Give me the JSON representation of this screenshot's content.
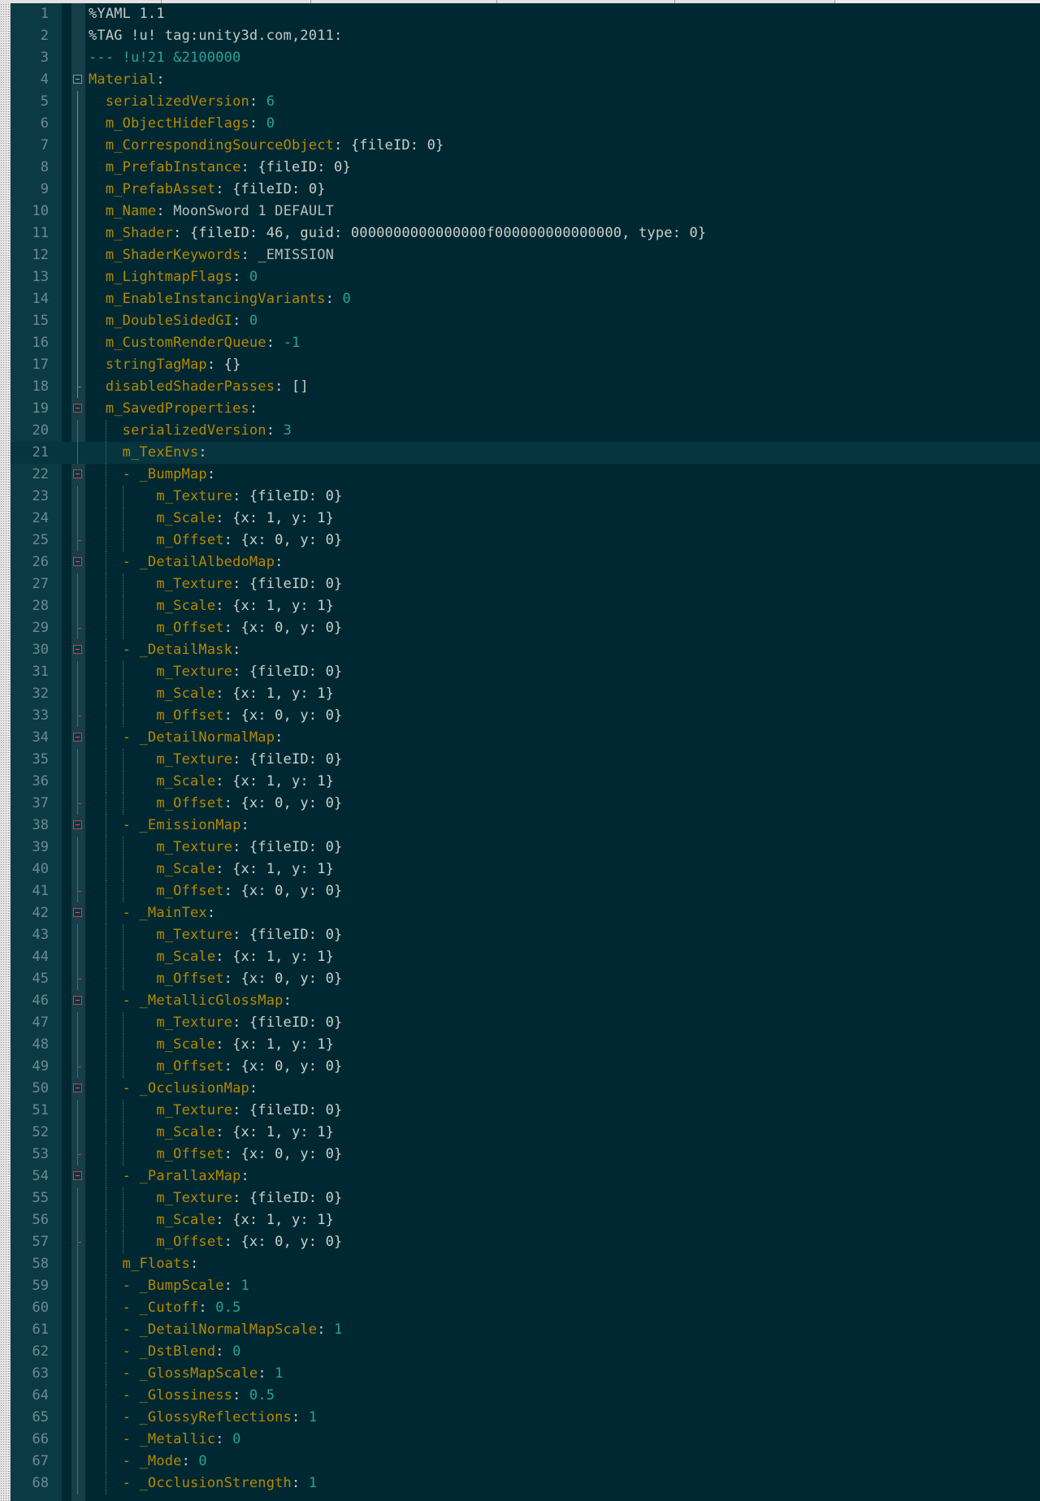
{
  "editor": {
    "colors": {
      "background": "#002833",
      "line_number": "#6d8a92",
      "directive": "#c4cac4",
      "document_marker": "#2aa198",
      "key": "#b58900",
      "string": "#b7bfb7",
      "number": "#2aa198",
      "punct": "#c9d1c9",
      "fold_marker": "#d23b45"
    },
    "current_line": 21,
    "lines": [
      {
        "n": "1",
        "tokens": [
          [
            "dir",
            "%YAML 1.1"
          ]
        ]
      },
      {
        "n": "2",
        "tokens": [
          [
            "dir",
            "%TAG !u! tag:unity3d.com,2011:"
          ]
        ]
      },
      {
        "n": "3",
        "tokens": [
          [
            "doc",
            "--- !u!21 &2100000"
          ]
        ]
      },
      {
        "n": "4",
        "tokens": [
          [
            "key",
            "Material"
          ],
          [
            "p",
            ":"
          ]
        ]
      },
      {
        "n": "5",
        "tokens": [
          [
            "sp",
            "  "
          ],
          [
            "key",
            "serializedVersion"
          ],
          [
            "p",
            ": "
          ],
          [
            "num",
            "6"
          ]
        ]
      },
      {
        "n": "6",
        "tokens": [
          [
            "sp",
            "  "
          ],
          [
            "key",
            "m_ObjectHideFlags"
          ],
          [
            "p",
            ": "
          ],
          [
            "num",
            "0"
          ]
        ]
      },
      {
        "n": "7",
        "tokens": [
          [
            "sp",
            "  "
          ],
          [
            "key",
            "m_CorrespondingSourceObject"
          ],
          [
            "p",
            ": {fileID: 0}"
          ]
        ]
      },
      {
        "n": "8",
        "tokens": [
          [
            "sp",
            "  "
          ],
          [
            "key",
            "m_PrefabInstance"
          ],
          [
            "p",
            ": {fileID: 0}"
          ]
        ]
      },
      {
        "n": "9",
        "tokens": [
          [
            "sp",
            "  "
          ],
          [
            "key",
            "m_PrefabAsset"
          ],
          [
            "p",
            ": {fileID: 0}"
          ]
        ]
      },
      {
        "n": "10",
        "tokens": [
          [
            "sp",
            "  "
          ],
          [
            "key",
            "m_Name"
          ],
          [
            "p",
            ": "
          ],
          [
            "str",
            "MoonSword 1 DEFAULT"
          ]
        ]
      },
      {
        "n": "11",
        "tokens": [
          [
            "sp",
            "  "
          ],
          [
            "key",
            "m_Shader"
          ],
          [
            "p",
            ": {fileID: 46, guid: 0000000000000000f000000000000000, type: 0}"
          ]
        ]
      },
      {
        "n": "12",
        "tokens": [
          [
            "sp",
            "  "
          ],
          [
            "key",
            "m_ShaderKeywords"
          ],
          [
            "p",
            ": "
          ],
          [
            "str",
            "_EMISSION"
          ]
        ]
      },
      {
        "n": "13",
        "tokens": [
          [
            "sp",
            "  "
          ],
          [
            "key",
            "m_LightmapFlags"
          ],
          [
            "p",
            ": "
          ],
          [
            "num",
            "0"
          ]
        ]
      },
      {
        "n": "14",
        "tokens": [
          [
            "sp",
            "  "
          ],
          [
            "key",
            "m_EnableInstancingVariants"
          ],
          [
            "p",
            ": "
          ],
          [
            "num",
            "0"
          ]
        ]
      },
      {
        "n": "15",
        "tokens": [
          [
            "sp",
            "  "
          ],
          [
            "key",
            "m_DoubleSidedGI"
          ],
          [
            "p",
            ": "
          ],
          [
            "num",
            "0"
          ]
        ]
      },
      {
        "n": "16",
        "tokens": [
          [
            "sp",
            "  "
          ],
          [
            "key",
            "m_CustomRenderQueue"
          ],
          [
            "p",
            ": "
          ],
          [
            "num",
            "-1"
          ]
        ]
      },
      {
        "n": "17",
        "tokens": [
          [
            "sp",
            "  "
          ],
          [
            "key",
            "stringTagMap"
          ],
          [
            "p",
            ": {}"
          ]
        ]
      },
      {
        "n": "18",
        "tokens": [
          [
            "sp",
            "  "
          ],
          [
            "key",
            "disabledShaderPasses"
          ],
          [
            "p",
            ": []"
          ]
        ]
      },
      {
        "n": "19",
        "tokens": [
          [
            "sp",
            "  "
          ],
          [
            "key",
            "m_SavedProperties"
          ],
          [
            "p",
            ":"
          ]
        ]
      },
      {
        "n": "20",
        "tokens": [
          [
            "sp",
            "    "
          ],
          [
            "key",
            "serializedVersion"
          ],
          [
            "p",
            ": "
          ],
          [
            "num",
            "3"
          ]
        ]
      },
      {
        "n": "21",
        "tokens": [
          [
            "sp",
            "    "
          ],
          [
            "key",
            "m_TexEnvs"
          ],
          [
            "p",
            ":"
          ]
        ]
      },
      {
        "n": "22",
        "tokens": [
          [
            "sp",
            "    "
          ],
          [
            "key",
            "- _BumpMap"
          ],
          [
            "p",
            ":"
          ]
        ]
      },
      {
        "n": "23",
        "tokens": [
          [
            "sp",
            "        "
          ],
          [
            "key",
            "m_Texture"
          ],
          [
            "p",
            ": {fileID: 0}"
          ]
        ]
      },
      {
        "n": "24",
        "tokens": [
          [
            "sp",
            "        "
          ],
          [
            "key",
            "m_Scale"
          ],
          [
            "p",
            ": {x: 1, y: 1}"
          ]
        ]
      },
      {
        "n": "25",
        "tokens": [
          [
            "sp",
            "        "
          ],
          [
            "key",
            "m_Offset"
          ],
          [
            "p",
            ": {x: 0, y: 0}"
          ]
        ]
      },
      {
        "n": "26",
        "tokens": [
          [
            "sp",
            "    "
          ],
          [
            "key",
            "- _DetailAlbedoMap"
          ],
          [
            "p",
            ":"
          ]
        ]
      },
      {
        "n": "27",
        "tokens": [
          [
            "sp",
            "        "
          ],
          [
            "key",
            "m_Texture"
          ],
          [
            "p",
            ": {fileID: 0}"
          ]
        ]
      },
      {
        "n": "28",
        "tokens": [
          [
            "sp",
            "        "
          ],
          [
            "key",
            "m_Scale"
          ],
          [
            "p",
            ": {x: 1, y: 1}"
          ]
        ]
      },
      {
        "n": "29",
        "tokens": [
          [
            "sp",
            "        "
          ],
          [
            "key",
            "m_Offset"
          ],
          [
            "p",
            ": {x: 0, y: 0}"
          ]
        ]
      },
      {
        "n": "30",
        "tokens": [
          [
            "sp",
            "    "
          ],
          [
            "key",
            "- _DetailMask"
          ],
          [
            "p",
            ":"
          ]
        ]
      },
      {
        "n": "31",
        "tokens": [
          [
            "sp",
            "        "
          ],
          [
            "key",
            "m_Texture"
          ],
          [
            "p",
            ": {fileID: 0}"
          ]
        ]
      },
      {
        "n": "32",
        "tokens": [
          [
            "sp",
            "        "
          ],
          [
            "key",
            "m_Scale"
          ],
          [
            "p",
            ": {x: 1, y: 1}"
          ]
        ]
      },
      {
        "n": "33",
        "tokens": [
          [
            "sp",
            "        "
          ],
          [
            "key",
            "m_Offset"
          ],
          [
            "p",
            ": {x: 0, y: 0}"
          ]
        ]
      },
      {
        "n": "34",
        "tokens": [
          [
            "sp",
            "    "
          ],
          [
            "key",
            "- _DetailNormalMap"
          ],
          [
            "p",
            ":"
          ]
        ]
      },
      {
        "n": "35",
        "tokens": [
          [
            "sp",
            "        "
          ],
          [
            "key",
            "m_Texture"
          ],
          [
            "p",
            ": {fileID: 0}"
          ]
        ]
      },
      {
        "n": "36",
        "tokens": [
          [
            "sp",
            "        "
          ],
          [
            "key",
            "m_Scale"
          ],
          [
            "p",
            ": {x: 1, y: 1}"
          ]
        ]
      },
      {
        "n": "37",
        "tokens": [
          [
            "sp",
            "        "
          ],
          [
            "key",
            "m_Offset"
          ],
          [
            "p",
            ": {x: 0, y: 0}"
          ]
        ]
      },
      {
        "n": "38",
        "tokens": [
          [
            "sp",
            "    "
          ],
          [
            "key",
            "- _EmissionMap"
          ],
          [
            "p",
            ":"
          ]
        ]
      },
      {
        "n": "39",
        "tokens": [
          [
            "sp",
            "        "
          ],
          [
            "key",
            "m_Texture"
          ],
          [
            "p",
            ": {fileID: 0}"
          ]
        ]
      },
      {
        "n": "40",
        "tokens": [
          [
            "sp",
            "        "
          ],
          [
            "key",
            "m_Scale"
          ],
          [
            "p",
            ": {x: 1, y: 1}"
          ]
        ]
      },
      {
        "n": "41",
        "tokens": [
          [
            "sp",
            "        "
          ],
          [
            "key",
            "m_Offset"
          ],
          [
            "p",
            ": {x: 0, y: 0}"
          ]
        ]
      },
      {
        "n": "42",
        "tokens": [
          [
            "sp",
            "    "
          ],
          [
            "key",
            "- _MainTex"
          ],
          [
            "p",
            ":"
          ]
        ]
      },
      {
        "n": "43",
        "tokens": [
          [
            "sp",
            "        "
          ],
          [
            "key",
            "m_Texture"
          ],
          [
            "p",
            ": {fileID: 0}"
          ]
        ]
      },
      {
        "n": "44",
        "tokens": [
          [
            "sp",
            "        "
          ],
          [
            "key",
            "m_Scale"
          ],
          [
            "p",
            ": {x: 1, y: 1}"
          ]
        ]
      },
      {
        "n": "45",
        "tokens": [
          [
            "sp",
            "        "
          ],
          [
            "key",
            "m_Offset"
          ],
          [
            "p",
            ": {x: 0, y: 0}"
          ]
        ]
      },
      {
        "n": "46",
        "tokens": [
          [
            "sp",
            "    "
          ],
          [
            "key",
            "- _MetallicGlossMap"
          ],
          [
            "p",
            ":"
          ]
        ]
      },
      {
        "n": "47",
        "tokens": [
          [
            "sp",
            "        "
          ],
          [
            "key",
            "m_Texture"
          ],
          [
            "p",
            ": {fileID: 0}"
          ]
        ]
      },
      {
        "n": "48",
        "tokens": [
          [
            "sp",
            "        "
          ],
          [
            "key",
            "m_Scale"
          ],
          [
            "p",
            ": {x: 1, y: 1}"
          ]
        ]
      },
      {
        "n": "49",
        "tokens": [
          [
            "sp",
            "        "
          ],
          [
            "key",
            "m_Offset"
          ],
          [
            "p",
            ": {x: 0, y: 0}"
          ]
        ]
      },
      {
        "n": "50",
        "tokens": [
          [
            "sp",
            "    "
          ],
          [
            "key",
            "- _OcclusionMap"
          ],
          [
            "p",
            ":"
          ]
        ]
      },
      {
        "n": "51",
        "tokens": [
          [
            "sp",
            "        "
          ],
          [
            "key",
            "m_Texture"
          ],
          [
            "p",
            ": {fileID: 0}"
          ]
        ]
      },
      {
        "n": "52",
        "tokens": [
          [
            "sp",
            "        "
          ],
          [
            "key",
            "m_Scale"
          ],
          [
            "p",
            ": {x: 1, y: 1}"
          ]
        ]
      },
      {
        "n": "53",
        "tokens": [
          [
            "sp",
            "        "
          ],
          [
            "key",
            "m_Offset"
          ],
          [
            "p",
            ": {x: 0, y: 0}"
          ]
        ]
      },
      {
        "n": "54",
        "tokens": [
          [
            "sp",
            "    "
          ],
          [
            "key",
            "- _ParallaxMap"
          ],
          [
            "p",
            ":"
          ]
        ]
      },
      {
        "n": "55",
        "tokens": [
          [
            "sp",
            "        "
          ],
          [
            "key",
            "m_Texture"
          ],
          [
            "p",
            ": {fileID: 0}"
          ]
        ]
      },
      {
        "n": "56",
        "tokens": [
          [
            "sp",
            "        "
          ],
          [
            "key",
            "m_Scale"
          ],
          [
            "p",
            ": {x: 1, y: 1}"
          ]
        ]
      },
      {
        "n": "57",
        "tokens": [
          [
            "sp",
            "        "
          ],
          [
            "key",
            "m_Offset"
          ],
          [
            "p",
            ": {x: 0, y: 0}"
          ]
        ]
      },
      {
        "n": "58",
        "tokens": [
          [
            "sp",
            "    "
          ],
          [
            "key",
            "m_Floats"
          ],
          [
            "p",
            ":"
          ]
        ]
      },
      {
        "n": "59",
        "tokens": [
          [
            "sp",
            "    "
          ],
          [
            "key",
            "- _BumpScale"
          ],
          [
            "p",
            ": "
          ],
          [
            "num",
            "1"
          ]
        ]
      },
      {
        "n": "60",
        "tokens": [
          [
            "sp",
            "    "
          ],
          [
            "key",
            "- _Cutoff"
          ],
          [
            "p",
            ": "
          ],
          [
            "num",
            "0.5"
          ]
        ]
      },
      {
        "n": "61",
        "tokens": [
          [
            "sp",
            "    "
          ],
          [
            "key",
            "- _DetailNormalMapScale"
          ],
          [
            "p",
            ": "
          ],
          [
            "num",
            "1"
          ]
        ]
      },
      {
        "n": "62",
        "tokens": [
          [
            "sp",
            "    "
          ],
          [
            "key",
            "- _DstBlend"
          ],
          [
            "p",
            ": "
          ],
          [
            "num",
            "0"
          ]
        ]
      },
      {
        "n": "63",
        "tokens": [
          [
            "sp",
            "    "
          ],
          [
            "key",
            "- _GlossMapScale"
          ],
          [
            "p",
            ": "
          ],
          [
            "num",
            "1"
          ]
        ]
      },
      {
        "n": "64",
        "tokens": [
          [
            "sp",
            "    "
          ],
          [
            "key",
            "- _Glossiness"
          ],
          [
            "p",
            ": "
          ],
          [
            "num",
            "0.5"
          ]
        ]
      },
      {
        "n": "65",
        "tokens": [
          [
            "sp",
            "    "
          ],
          [
            "key",
            "- _GlossyReflections"
          ],
          [
            "p",
            ": "
          ],
          [
            "num",
            "1"
          ]
        ]
      },
      {
        "n": "66",
        "tokens": [
          [
            "sp",
            "    "
          ],
          [
            "key",
            "- _Metallic"
          ],
          [
            "p",
            ": "
          ],
          [
            "num",
            "0"
          ]
        ]
      },
      {
        "n": "67",
        "tokens": [
          [
            "sp",
            "    "
          ],
          [
            "key",
            "- _Mode"
          ],
          [
            "p",
            ": "
          ],
          [
            "num",
            "0"
          ]
        ]
      },
      {
        "n": "68",
        "tokens": [
          [
            "sp",
            "    "
          ],
          [
            "key",
            "- _OcclusionStrength"
          ],
          [
            "p",
            ": "
          ],
          [
            "num",
            "1"
          ]
        ]
      }
    ]
  }
}
